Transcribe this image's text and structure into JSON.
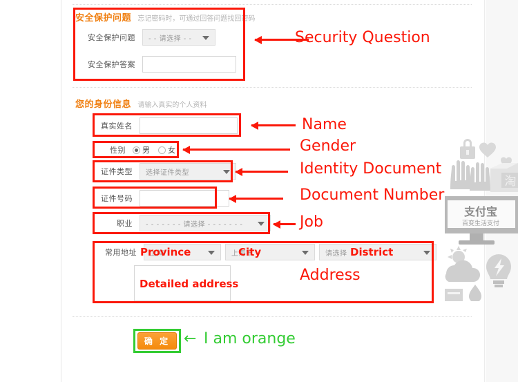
{
  "sections": {
    "security": {
      "title": "安全保护问题",
      "subtitle": "忘记密码时，可通过回答问题找回密码",
      "rows": [
        {
          "label": "安全保护问题",
          "value": "- - 请选择 - -",
          "type": "select"
        },
        {
          "label": "安全保护答案",
          "value": "",
          "type": "text"
        }
      ]
    },
    "identity": {
      "title": "您的身份信息",
      "subtitle": "请输入真实的个人资料",
      "rows": [
        {
          "label": "真实姓名",
          "value": "",
          "type": "text"
        },
        {
          "label": "性别",
          "type": "radio",
          "options": [
            "男",
            "女"
          ],
          "selected": "男"
        },
        {
          "label": "证件类型",
          "value": "选择证件类型",
          "type": "select"
        },
        {
          "label": "证件号码",
          "value": "",
          "type": "text"
        },
        {
          "label": "职业",
          "value": "- - - - - - - 请选择 - - - - - - -",
          "type": "select"
        },
        {
          "label": "常用地址",
          "type": "address"
        }
      ],
      "address": {
        "province": "上海",
        "city": "上海市",
        "district": "请选择",
        "detail": ""
      }
    }
  },
  "submit": {
    "label": "确 定"
  },
  "annotations": {
    "security_question": "Security Question",
    "name": "Name",
    "gender": "Gender",
    "identity_document": "Identity Document",
    "document_number": "Document Number",
    "job": "Job",
    "address": "Address",
    "i_am_orange": "I am orange",
    "province_label": "Province",
    "city_label": "City",
    "district_label": "District",
    "detailed_address_label": "Detailed address",
    "arrow_left_glyph": "←"
  },
  "watermark": {
    "brand": "支付宝",
    "tagline": "百变生活支付",
    "box_char": "淘"
  },
  "colors": {
    "annotation_red": "#fb1809",
    "annotation_green": "#33cc33",
    "section_orange": "#f08013",
    "button_orange": "#f58b0d"
  }
}
